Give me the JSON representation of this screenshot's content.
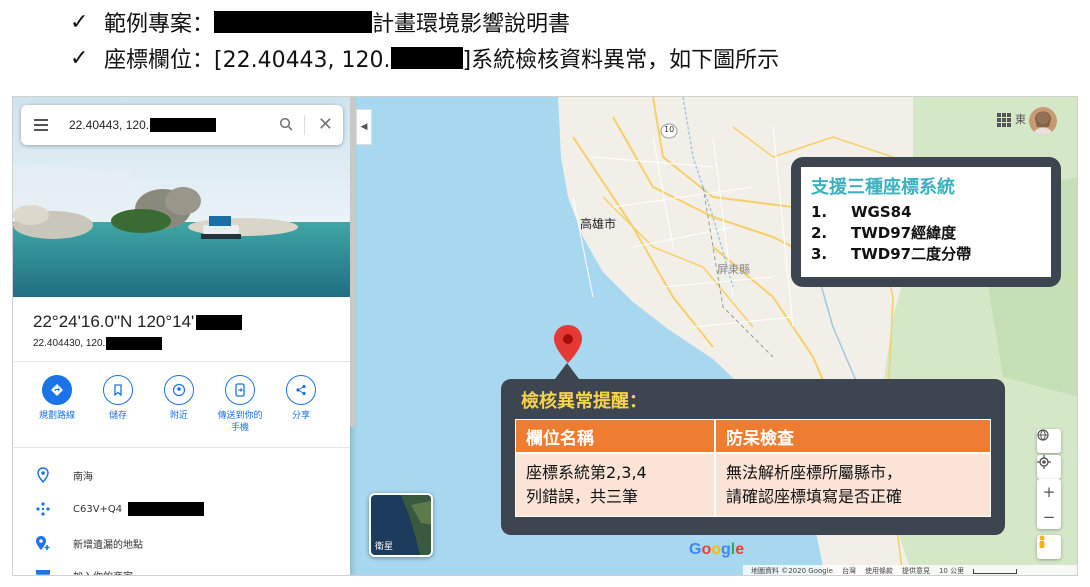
{
  "bullets": {
    "check": "✓",
    "line1": {
      "prefix": "範例專案：",
      "suffix": "計畫環境影響說明書"
    },
    "line2": {
      "prefix": "座標欄位：[22.40443, 120.",
      "suffix": "]系統檢核資料異常，如下圖所示"
    }
  },
  "maps_panel": {
    "search": {
      "value": "22.40443, 120."
    },
    "place": {
      "dms": "22°24'16.0\"N 120°14'",
      "decimal": "22.404430, 120."
    },
    "actions": [
      {
        "icon": "directions-icon",
        "label": "規劃路線"
      },
      {
        "icon": "bookmark-icon",
        "label": "儲存"
      },
      {
        "icon": "nearby-icon",
        "label": "附近"
      },
      {
        "icon": "send-to-phone-icon",
        "label": "傳送到你的\n手機"
      },
      {
        "icon": "share-icon",
        "label": "分享"
      }
    ],
    "info": [
      {
        "icon": "location-pin-icon",
        "text": "南海"
      },
      {
        "icon": "plus-code-icon",
        "text": "C63V+Q4"
      },
      {
        "icon": "add-place-icon",
        "text": "新增遺漏的地點"
      },
      {
        "icon": "business-icon",
        "text": "加入你的商家"
      }
    ]
  },
  "map": {
    "labels": {
      "kaohsiung": "高雄市",
      "pingtung": "屏東縣",
      "east": "東",
      "road_10": "10",
      "satellite": "衛星"
    },
    "logo": {
      "text": "Google",
      "colors": [
        "#4285F4",
        "#EA4335",
        "#FBBC05",
        "#4285F4",
        "#34A853",
        "#EA4335"
      ]
    },
    "footer": [
      "地圖資料 ©2020 Google",
      "台灣",
      "使用條款",
      "提供意見",
      "10 公里"
    ]
  },
  "callout_systems": {
    "title": "支援三種座標系統",
    "items": [
      {
        "n": "1.",
        "text": "WGS84"
      },
      {
        "n": "2.",
        "text": "TWD97經緯度"
      },
      {
        "n": "3.",
        "text": "TWD97二度分帶"
      }
    ]
  },
  "callout_alert": {
    "title": "檢核異常提醒：",
    "headers": [
      "欄位名稱",
      "防呆檢查"
    ],
    "row": [
      "座標系統第2,3,4\n列錯誤，共三筆",
      "無法解析座標所屬縣市，\n請確認座標填寫是否正確"
    ]
  },
  "colors": {
    "accent_teal": "#3cb1c0",
    "alert_yellow": "#f7d34a",
    "table_header": "#ee7c31",
    "table_cell": "#fbe4d6",
    "callout_bg": "#3d4550",
    "maps_blue": "#1a73e8",
    "pin_red": "#e53935"
  }
}
